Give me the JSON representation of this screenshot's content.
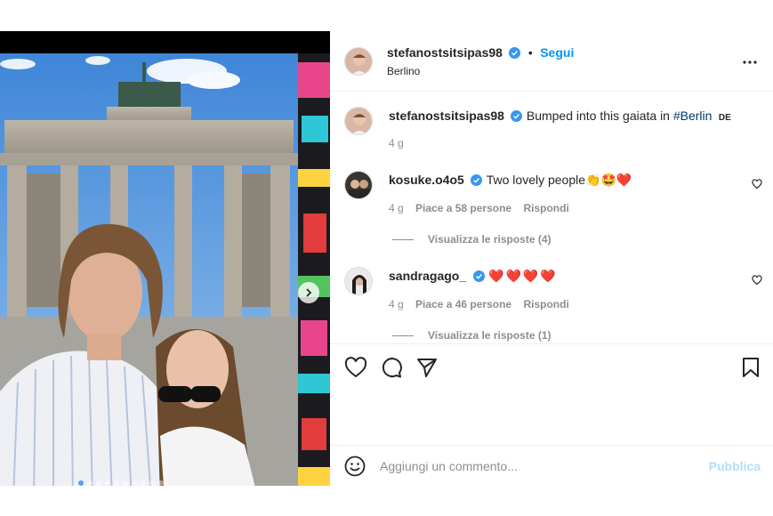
{
  "post": {
    "author": "stefanostsitsipas98",
    "follow_label": "Segui",
    "separator": "•",
    "location": "Berlino"
  },
  "caption": {
    "author": "stefanostsitsipas98",
    "text": "Bumped into this gaiata in ",
    "hashtag": "#Berlin",
    "flag": "DE",
    "time": "4 g"
  },
  "comments": [
    {
      "author": "kosuke.o4o5",
      "text": "Two lovely people",
      "emojis": [
        "👏",
        "🤩",
        "❤️"
      ],
      "time": "4 g",
      "likes": "Piace a 58 persone",
      "reply_label": "Rispondi",
      "view_replies": "Visualizza le risposte (4)"
    },
    {
      "author": "sandragago_",
      "text": "",
      "emojis": [
        "❤️",
        "❤️",
        "❤️",
        "❤️"
      ],
      "time": "4 g",
      "likes": "Piace a 46 persone",
      "reply_label": "Rispondi",
      "view_replies": "Visualizza le risposte (1)"
    }
  ],
  "add_comment": {
    "placeholder": "Aggiungi un commento...",
    "publish_label": "Pubblica"
  },
  "carousel": {
    "current_slide": 1,
    "total_slides": 10
  },
  "icons": {
    "verified": "verified-badge-icon",
    "more": "more-options-icon",
    "like": "heart-icon",
    "comment": "comment-icon",
    "share": "send-icon",
    "save": "bookmark-icon",
    "emoji": "emoji-icon",
    "next": "chevron-right-icon"
  },
  "colors": {
    "accent": "#0095f6",
    "publish_disabled": "#b2dffc",
    "verified": "#3897f0"
  }
}
